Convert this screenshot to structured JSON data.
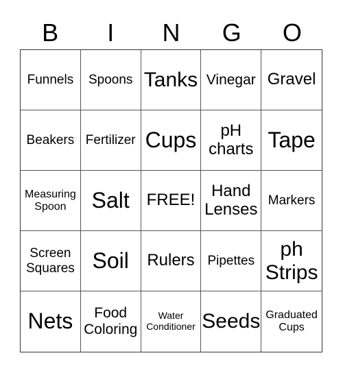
{
  "header": [
    "B",
    "I",
    "N",
    "G",
    "O"
  ],
  "cells": [
    "Funnels",
    "Spoons",
    "Tanks",
    "Vinegar",
    "Gravel",
    "Beakers",
    "Fertilizer",
    "Cups",
    "pH charts",
    "Tape",
    "Measuring Spoon",
    "Salt",
    "FREE!",
    "Hand Lenses",
    "Markers",
    "Screen Squares",
    "Soil",
    "Rulers",
    "Pipettes",
    "ph Strips",
    "Nets",
    "Food Coloring",
    "Water Conditioner",
    "Seeds",
    "Graduated Cups"
  ]
}
